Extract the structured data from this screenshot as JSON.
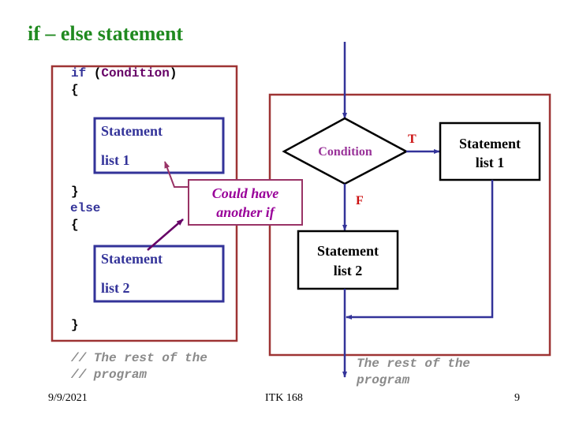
{
  "slide": {
    "title": "if – else statement",
    "footer": {
      "date": "9/9/2021",
      "course": "ITK 168",
      "page": "9"
    }
  },
  "code": {
    "if_keyword": "if",
    "open_paren": " (",
    "condition": "Condition",
    "close_paren": ")",
    "open_brace_if": "{",
    "stmt1_line1": "Statement",
    "stmt1_line2": "list 1",
    "close_brace_if": "}",
    "else_keyword": "else",
    "open_brace_else": "{",
    "stmt2_line1": "Statement",
    "stmt2_line2": "list 2",
    "close_brace_else": "}",
    "comment_line1": "// The rest of the",
    "comment_line2": "// program"
  },
  "callout": {
    "line1": "Could have",
    "line2": "another if"
  },
  "flowchart": {
    "decision_label": "Condition",
    "true_label": "T",
    "false_label": "F",
    "true_box": {
      "line1": "Statement",
      "line2": "list 1"
    },
    "false_box": {
      "line1": "Statement",
      "line2": "list 2"
    },
    "exit_line1": "The rest of the",
    "exit_line2": "program"
  },
  "colors": {
    "title": "#208a20",
    "frame_red": "#9e3434",
    "flow_blue": "#333399",
    "callout_border": "#993366",
    "callout_text": "#990099",
    "true_false_labels": "#cc1111",
    "comment_gray": "#8a8a8a"
  }
}
